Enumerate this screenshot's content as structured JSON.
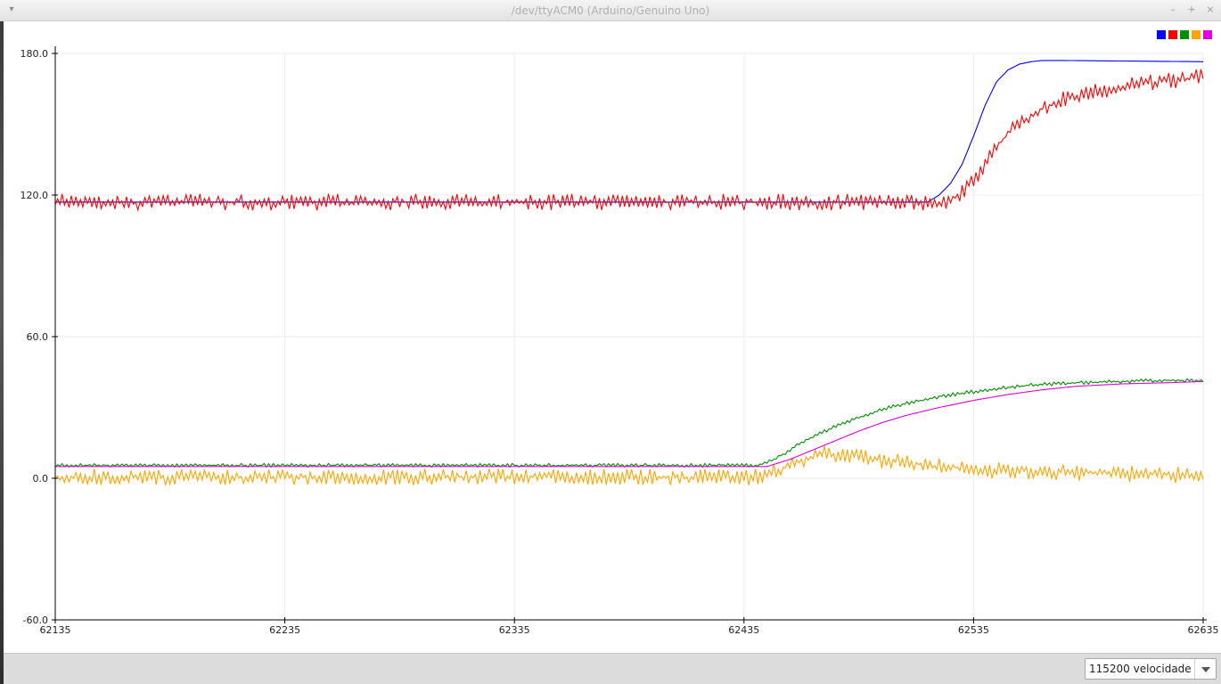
{
  "window": {
    "title": "/dev/ttyACM0 (Arduino/Genuino Uno)",
    "menu_icon": "chevron-down-icon",
    "controls": [
      "minimize-icon",
      "maximize-icon",
      "close-icon"
    ],
    "control_glyphs": [
      "–",
      "+",
      "×"
    ]
  },
  "chart_data": {
    "type": "line",
    "x_range": [
      62135,
      62635
    ],
    "ylim": [
      -60,
      180
    ],
    "x_ticks": [
      62135,
      62235,
      62335,
      62435,
      62535,
      62635
    ],
    "x_tick_labels": [
      "62135",
      "62235",
      "62335",
      "62435",
      "62535",
      "62635"
    ],
    "y_ticks": [
      -60,
      0,
      60,
      120,
      180
    ],
    "y_tick_labels": [
      "-60.0",
      "0.0",
      "60.0",
      "120.0",
      "180.0"
    ],
    "grid": true,
    "legend_position": "top-right",
    "series": [
      {
        "color": "#0000ff",
        "x": [
          62135,
          62515,
          62520,
          62525,
          62530,
          62535,
          62540,
          62545,
          62550,
          62555,
          62560,
          62565,
          62575,
          62635
        ],
        "y": [
          117,
          117,
          120,
          125,
          133,
          145,
          158,
          168,
          173,
          175.5,
          176.5,
          177,
          177,
          176.5
        ]
      },
      {
        "color": "#ff0000",
        "noise": 3.5,
        "x": [
          62135,
          62520,
          62525,
          62530,
          62535,
          62540,
          62545,
          62550,
          62555,
          62560,
          62565,
          62570,
          62575,
          62585,
          62595,
          62605,
          62615,
          62625,
          62635
        ],
        "y": [
          117,
          117,
          118,
          121,
          126,
          133,
          140,
          146,
          150,
          154,
          157,
          159,
          161,
          163,
          165,
          167,
          168,
          169,
          170
        ]
      },
      {
        "color": "#008f00",
        "noise": 0.8,
        "x": [
          62135,
          62440,
          62445,
          62450,
          62460,
          62470,
          62480,
          62490,
          62500,
          62510,
          62520,
          62530,
          62545,
          62560,
          62580,
          62600,
          62620,
          62635
        ],
        "y": [
          5.5,
          5.5,
          6.5,
          9,
          15,
          20,
          24,
          27.5,
          30.5,
          32.5,
          34.5,
          36,
          38,
          39.5,
          40.5,
          41,
          41.5,
          41.5
        ]
      },
      {
        "color": "#ffa500",
        "noise": 3.5,
        "x": [
          62135,
          62440,
          62450,
          62460,
          62470,
          62480,
          62490,
          62500,
          62520,
          62540,
          62560,
          62580,
          62600,
          62620,
          62635
        ],
        "y": [
          0.5,
          0.5,
          3.5,
          7.5,
          10.5,
          10,
          8.5,
          7,
          5,
          3.5,
          3,
          2.5,
          2,
          1.5,
          1
        ]
      },
      {
        "color": "#e000e0",
        "x": [
          62135,
          62445,
          62455,
          62465,
          62475,
          62485,
          62495,
          62505,
          62520,
          62535,
          62550,
          62565,
          62580,
          62600,
          62620,
          62635
        ],
        "y": [
          5,
          5,
          8,
          12,
          16,
          20,
          23.5,
          26.5,
          30,
          33,
          35.5,
          37.5,
          39,
          40,
          40.5,
          41
        ]
      }
    ]
  },
  "baud": {
    "label": "115200 velocidade",
    "icon": "chevron-down-icon"
  }
}
